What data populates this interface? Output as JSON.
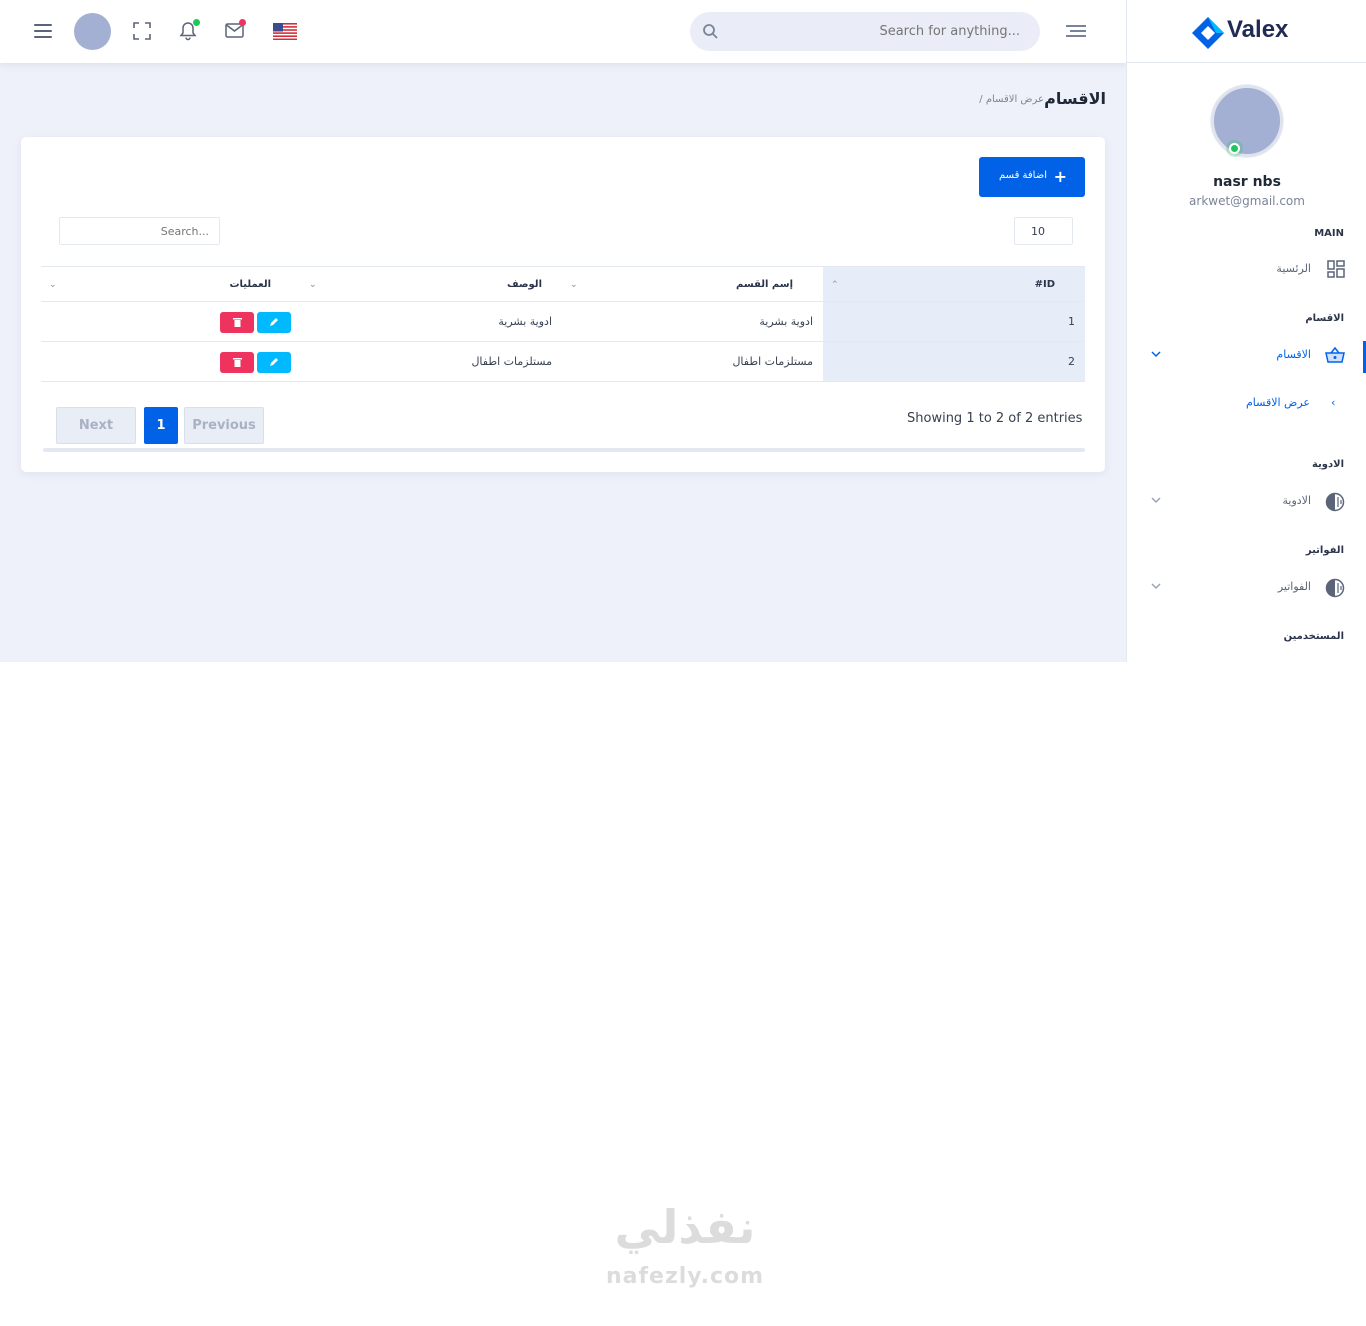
{
  "header": {
    "search_placeholder": "Search for anything..."
  },
  "sidebar": {
    "logo": "Valex",
    "user_name": "nasr nbs",
    "user_email": "arkwet@gmail.com",
    "sections": {
      "main": "MAIN",
      "categories": "الاقسام",
      "medicines": "الادوية",
      "invoices": "الفواتير",
      "users": "المستخدمين"
    },
    "items": {
      "dashboard": "الرئسية",
      "categories": "الاقسام",
      "categories_sub": "عرض الاقسام",
      "medicines": "الادوية",
      "invoices": "الفواتير"
    }
  },
  "breadcrumb": {
    "title": "الاقسام",
    "sub": "/ عرض الاقسام"
  },
  "card": {
    "add_button": "اضافة قسم",
    "page_length": "10",
    "search_placeholder": "Search...",
    "columns": {
      "id": "#ID",
      "name": "إسم القسم",
      "description": "الوصف",
      "operations": "العمليات"
    },
    "rows": [
      {
        "id": "1",
        "name": "ادوية بشرية",
        "description": "ادوية بشرية"
      },
      {
        "id": "2",
        "name": "مستلزمات اطفال",
        "description": "مستلزمات اطفال"
      }
    ],
    "info": "Showing 1 to 2 of 2 entries",
    "pagination": {
      "next": "Next",
      "page": "1",
      "previous": "Previous"
    }
  },
  "watermark": {
    "arabic": "نفذلي",
    "latin": "nafezly.com"
  },
  "colors": {
    "primary": "#0162e8",
    "info": "#00b9ff",
    "danger": "#ee335e",
    "background": "#eef1f9"
  }
}
